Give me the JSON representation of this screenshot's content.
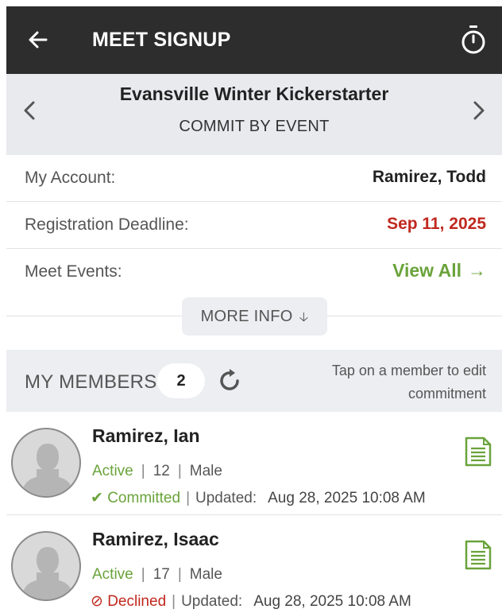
{
  "header": {
    "title": "MEET SIGNUP",
    "back_icon": "arrow-left-icon",
    "timer_icon": "stopwatch-icon"
  },
  "meet": {
    "name": "Evansville Winter Kickerstarter",
    "mode": "COMMIT BY EVENT"
  },
  "info": {
    "account_label": "My Account:",
    "account_value": "Ramirez, Todd",
    "deadline_label": "Registration Deadline:",
    "deadline_value": "Sep 11, 2025",
    "events_label": "Meet Events:",
    "events_link": "View All",
    "events_arrow": "→"
  },
  "more_info": {
    "label": "MORE INFO",
    "chevron": "🡣"
  },
  "members_section": {
    "title": "MY MEMBERS",
    "count": "2",
    "hint_line1": "Tap on a member to edit",
    "hint_line2": "commitment"
  },
  "members": [
    {
      "name": "Ramirez, Ian",
      "status": "Active",
      "age": "12",
      "gender": "Male",
      "commit_icon": "✔",
      "commit": "Committed",
      "updated_label": "Updated:",
      "updated": "Aug 28, 2025 10:08 AM"
    },
    {
      "name": "Ramirez, Isaac",
      "status": "Active",
      "age": "17",
      "gender": "Male",
      "commit_icon": "⊘",
      "commit": "Declined",
      "updated_label": "Updated:",
      "updated": "Aug 28, 2025 10:08 AM"
    }
  ],
  "colors": {
    "topbar": "#2d2d2d",
    "accent_green": "#6aa33b",
    "deadline_red": "#c0281e",
    "panel_gray": "#e8eaee"
  }
}
